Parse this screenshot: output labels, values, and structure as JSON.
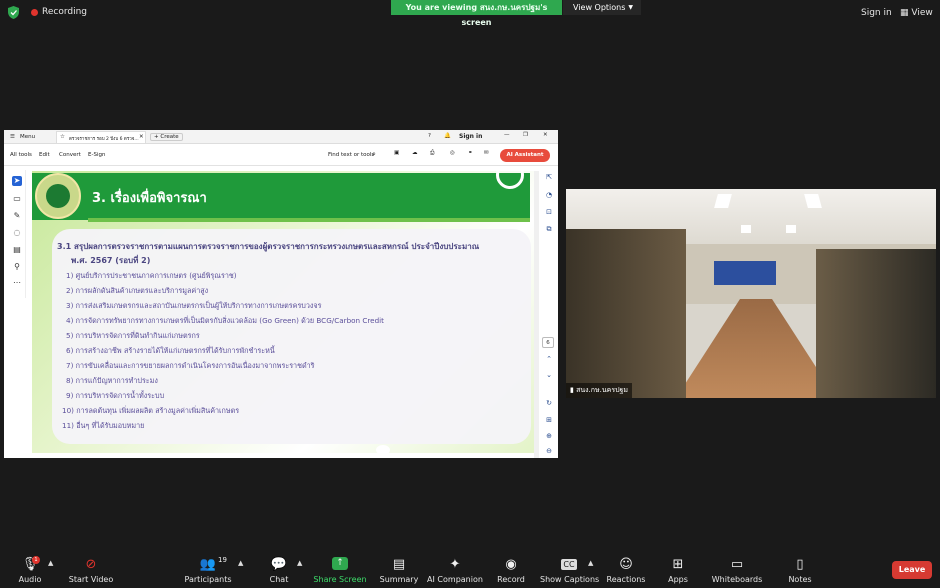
{
  "topbar": {
    "recording_label": "Recording",
    "viewing_banner": "You are viewing สนง.กษ.นครปฐม's screen",
    "view_options": "View Options",
    "sign_in": "Sign in",
    "view": "View"
  },
  "pdf": {
    "menu": "Menu",
    "tab_title": "ตรวจราชการ รอบ 2 ปีงบ 6 ตรวจ...",
    "create": "+ Create",
    "sign_in": "Sign in",
    "menus": [
      "All tools",
      "Edit",
      "Convert",
      "E-Sign"
    ],
    "find_text": "Find text or tools",
    "ai_assistant": "AI Assistant",
    "page_number": "6"
  },
  "slide": {
    "title": "3. เรื่องเพื่อพิจารณา",
    "heading_line1": "3.1 สรุปผลการตรวจราชการตามแผนการตรวจราชการของผู้ตรวจราชการกระทรวงเกษตรและสหกรณ์ ประจำปีงบประมาณ",
    "heading_line2": "พ.ศ. 2567 (รอบที่ 2)",
    "items": [
      "1) ศูนย์บริการประชาชนภาคการเกษตร (ศูนย์พิรุณราช)",
      "2) การผลักดันสินค้าเกษตรและบริการมูลค่าสูง",
      "3) การส่งเสริมเกษตรกรและสถาบันเกษตรกรเป็นผู้ให้บริการทางการเกษตรครบวงจร",
      "4) การจัดการทรัพยากรทางการเกษตรที่เป็นมิตรกับสิ่งแวดล้อม (Go Green) ด้วย BCG/Carbon Credit",
      "5) การบริหารจัดการที่ดินทำกินแก่เกษตรกร",
      "6) การสร้างอาชีพ สร้างรายได้ให้แก่เกษตรกรที่ได้รับการพักชำระหนี้",
      "7) การขับเคลื่อนและการขยายผลการดำเนินโครงการอันเนื่องมาจากพระราชดำริ",
      "8) การแก้ปัญหาการทำประมง",
      "9) การบริหารจัดการน้ำทั้งระบบ",
      "10) การลดต้นทุน เพิ่มผลผลิต สร้างมูลค่าเพิ่มสินค้าเกษตร",
      "11) อื่นๆ ที่ได้รับมอบหมาย"
    ]
  },
  "video": {
    "participant_name": "สนง.กษ.นครปฐม"
  },
  "toolbar": {
    "audio": "Audio",
    "audio_badge": "1",
    "start_video": "Start Video",
    "participants": "Participants",
    "participant_count": "19",
    "chat": "Chat",
    "share_screen": "Share Screen",
    "summary": "Summary",
    "ai_companion": "AI Companion",
    "record": "Record",
    "show_captions": "Show Captions",
    "reactions": "Reactions",
    "apps": "Apps",
    "whiteboards": "Whiteboards",
    "notes": "Notes",
    "leave": "Leave"
  },
  "colors": {
    "share_green": "#2fa84f",
    "leave_red": "#d63a32",
    "slide_green": "#1f9a3a",
    "slide_text": "#5b4f9a"
  }
}
